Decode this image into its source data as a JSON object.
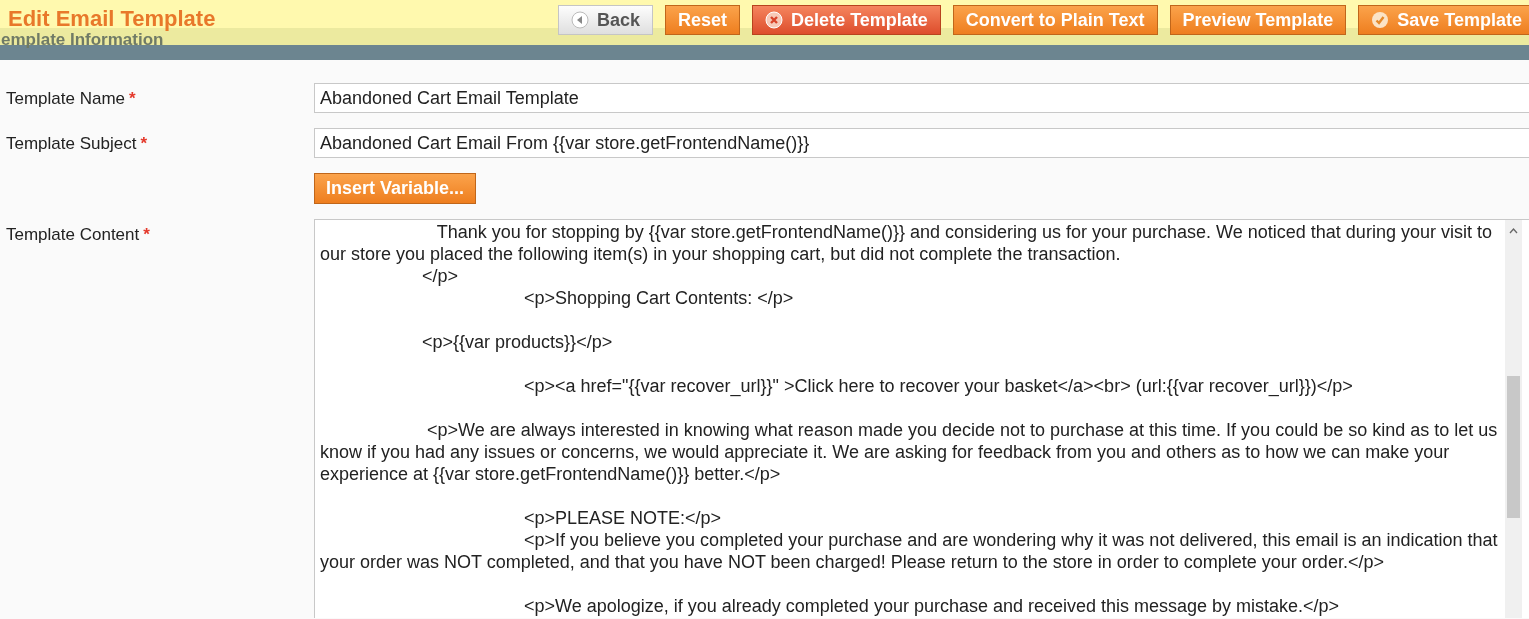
{
  "header": {
    "title": "Edit Email Template",
    "buttons": [
      {
        "label": "Back",
        "kind": "back"
      },
      {
        "label": "Reset",
        "kind": "plain"
      },
      {
        "label": "Delete Template",
        "kind": "delete"
      },
      {
        "label": "Convert to Plain Text",
        "kind": "plain"
      },
      {
        "label": "Preview Template",
        "kind": "plain"
      },
      {
        "label": "Save Template",
        "kind": "save"
      }
    ]
  },
  "section": {
    "title": "emplate Information"
  },
  "fields": [
    {
      "kind": "input",
      "label": "Template Name",
      "required_mark": "*",
      "value": "Abandoned Cart Email Template"
    },
    {
      "kind": "input",
      "label": "Template Subject",
      "required_mark": "*",
      "value": "Abandoned Cart Email From {{var store.getFrontendName()}}"
    },
    {
      "kind": "button",
      "label": "Insert Variable..."
    },
    {
      "kind": "textarea",
      "label": "Template Content",
      "required_mark": "*",
      "value": "\t   Thank you for stopping by {{var store.getFrontendName()}} and considering us for your purchase. We noticed that during your visit to our store you placed the following item(s) in your shopping cart, but did not complete the transaction.\n\t</p>\n\t\t<p>Shopping Cart Contents: </p>\n\n\t<p>{{var products}}</p>\n\n\t\t<p><a href=\"{{var recover_url}}\" >Click here to recover your basket</a><br> (url:{{var recover_url}})</p>\n\n\t <p>We are always interested in knowing what reason made you decide not to purchase at this time. If you could be so kind as to let us know if you had any issues or concerns, we would appreciate it. We are asking for feedback from you and others as to how we can make your experience at {{var store.getFrontendName()}} better.</p>\n\n\t\t<p>PLEASE NOTE:</p>\n\t\t<p>If you believe you completed your purchase and are wondering why it was not delivered, this email is an indication that your order was NOT completed, and that you have NOT been charged! Please return to the store in order to complete your order.</p>\n\n\t\t<p>We apologize, if you already completed your purchase and received this message by mistake.</p>"
    }
  ]
}
